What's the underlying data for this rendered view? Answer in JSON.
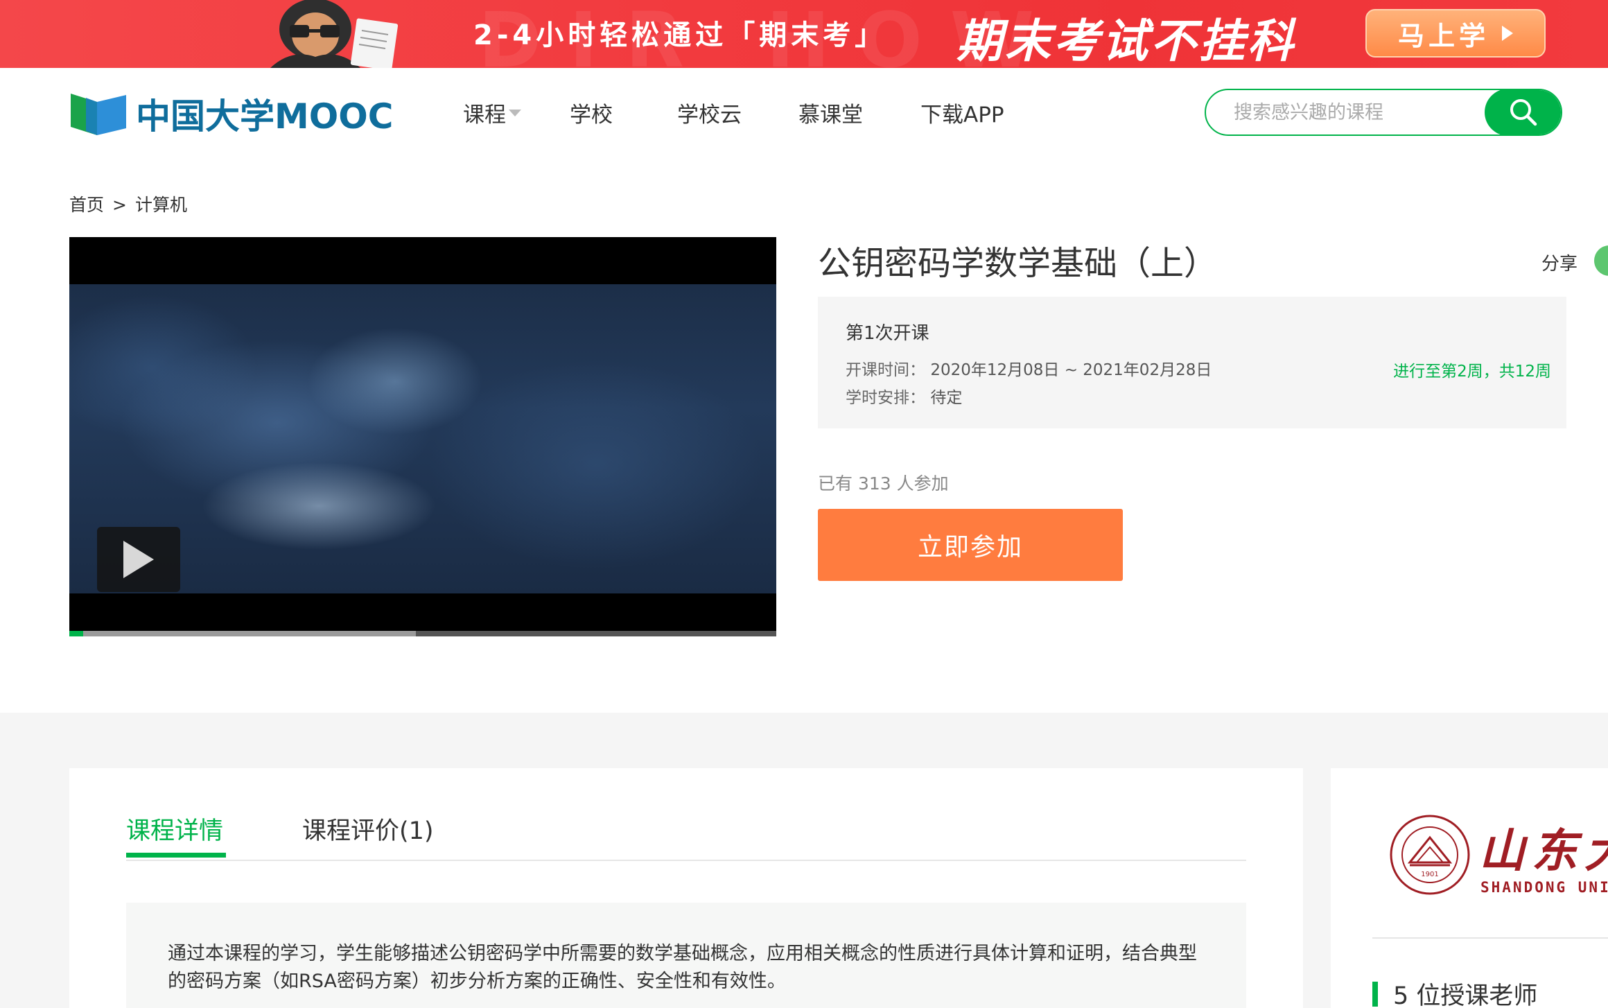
{
  "banner": {
    "deco_text": "DIR HOW",
    "headline": "2-4小时轻松通过「期末考」",
    "slogan": "期末考试不挂科",
    "cta_label": "马上学"
  },
  "header": {
    "logo_text": "中国大学MOOC",
    "nav": [
      {
        "label": "课程",
        "has_dropdown": true
      },
      {
        "label": "学校"
      },
      {
        "label": "学校云"
      },
      {
        "label": "慕课堂"
      },
      {
        "label": "下载APP"
      }
    ],
    "search_placeholder": "搜索感兴趣的课程"
  },
  "breadcrumb": {
    "home": "首页",
    "separator": ">",
    "current": "计算机"
  },
  "video": {
    "progress_loaded_fraction": 0.49,
    "progress_played_fraction": 0.02
  },
  "course": {
    "title": "公钥密码学数学基础（上）",
    "share_label": "分享",
    "term": {
      "title": "第1次开课",
      "time_label": "开课时间：",
      "time_value": "2020年12月08日 ~ 2021年02月28日",
      "hours_label": "学时安排：",
      "hours_value": "待定",
      "progress_text": "进行至第2周，共12周"
    },
    "enrolled_text": "已有 313 人参加",
    "join_label": "立即参加"
  },
  "details": {
    "tabs": [
      {
        "label": "课程详情",
        "active": true
      },
      {
        "label": "课程评价(1)",
        "active": false
      }
    ],
    "description": "通过本课程的学习，学生能够描述公钥密码学中所需要的数学基础概念，应用相关概念的性质进行具体计算和证明，结合典型的密码方案（如RSA密码方案）初步分析方案的正确性、安全性和有效性。"
  },
  "sidebar": {
    "university_cn": "山东大",
    "university_en": "SHANDONG UNIV",
    "seal_year": "1901",
    "teachers_label": "5 位授课老师"
  },
  "colors": {
    "brand_green": "#00b34a",
    "join_orange": "#ff7c3f",
    "banner_red": "#f23b3f",
    "university_red": "#a01e24"
  }
}
